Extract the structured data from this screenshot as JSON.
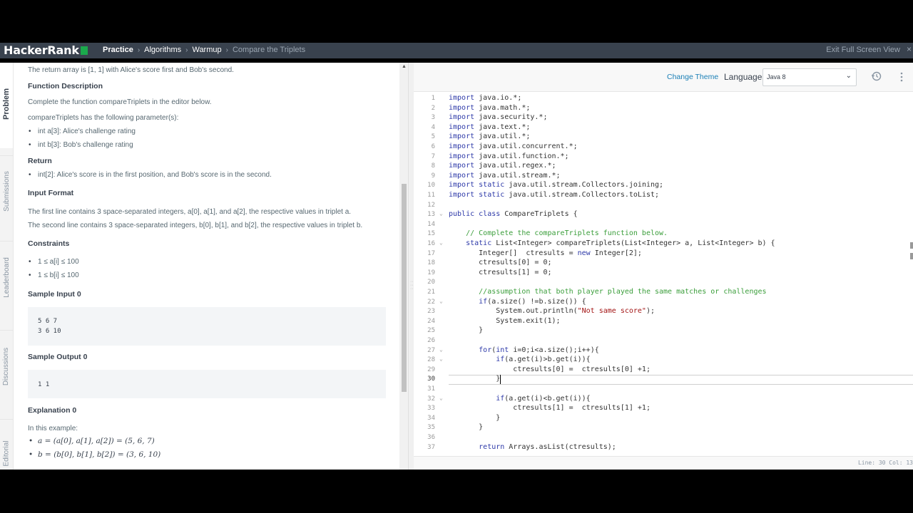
{
  "header": {
    "logo": "HackerRank",
    "breadcrumbs": [
      "Practice",
      "Algorithms",
      "Warmup",
      "Compare the Triplets"
    ],
    "exit_fullscreen": "Exit Full Screen View",
    "close_glyph": "×"
  },
  "side_tabs": [
    "Problem",
    "Submissions",
    "Leaderboard",
    "Discussions",
    "Editorial"
  ],
  "problem": {
    "return_array_text": "The return array is [1, 1] with Alice's score first and Bob's second.",
    "function_description_heading": "Function Description",
    "function_description_text": "Complete the function compareTriplets in the editor below.",
    "params_intro": "compareTriplets has the following parameter(s):",
    "params": [
      "int a[3]: Alice's challenge rating",
      "int b[3]: Bob's challenge rating"
    ],
    "return_heading": "Return",
    "return_items": [
      "int[2]: Alice's score is in the first position, and Bob's score is in the second."
    ],
    "input_format_heading": "Input Format",
    "input_format_lines": [
      "The first line contains 3 space-separated integers, a[0], a[1], and a[2], the respective values in triplet a.",
      "The second line contains 3 space-separated integers, b[0], b[1], and b[2], the respective values in triplet b."
    ],
    "constraints_heading": "Constraints",
    "constraints": [
      "1 ≤ a[i] ≤ 100",
      "1 ≤ b[i] ≤ 100"
    ],
    "sample_input_heading": "Sample Input 0",
    "sample_input_lines": [
      "5 6 7",
      "3 6 10"
    ],
    "sample_output_heading": "Sample Output 0",
    "sample_output": "1 1",
    "explanation_heading": "Explanation 0",
    "explanation_intro": "In this example:",
    "explanation_items": [
      "a = (a[0], a[1], a[2]) = (5, 6, 7)",
      "b = (b[0], b[1], b[2]) = (3, 6, 10)"
    ]
  },
  "editor": {
    "change_theme": "Change Theme",
    "language_label": "Language",
    "language_value": "Java 8",
    "status": "Line: 30 Col: 13",
    "current_line": 30,
    "code_lines": [
      "import java.io.*;",
      "import java.math.*;",
      "import java.security.*;",
      "import java.text.*;",
      "import java.util.*;",
      "import java.util.concurrent.*;",
      "import java.util.function.*;",
      "import java.util.regex.*;",
      "import java.util.stream.*;",
      "import static java.util.stream.Collectors.joining;",
      "import static java.util.stream.Collectors.toList;",
      "",
      "public class CompareTriplets {",
      "",
      "    // Complete the compareTriplets function below.",
      "    static List<Integer> compareTriplets(List<Integer> a, List<Integer> b) {",
      "       Integer[]  ctresults = new Integer[2];",
      "       ctresults[0] = 0;",
      "       ctresults[1] = 0;",
      "",
      "       //assumption that both player played the same matches or challenges",
      "       if(a.size() !=b.size()) {",
      "           System.out.println(\"Not same score\");",
      "           System.exit(1);",
      "       }",
      "",
      "       for(int i=0;i<a.size();i++){",
      "           if(a.get(i)>b.get(i)){",
      "               ctresults[0] =  ctresults[0] +1;",
      "           }",
      "",
      "           if(a.get(i)<b.get(i)){",
      "               ctresults[1] =  ctresults[1] +1;",
      "           }",
      "       }",
      "",
      "       return Arrays.asList(ctresults);"
    ],
    "fold_lines": [
      13,
      16,
      22,
      27,
      28,
      32
    ]
  }
}
